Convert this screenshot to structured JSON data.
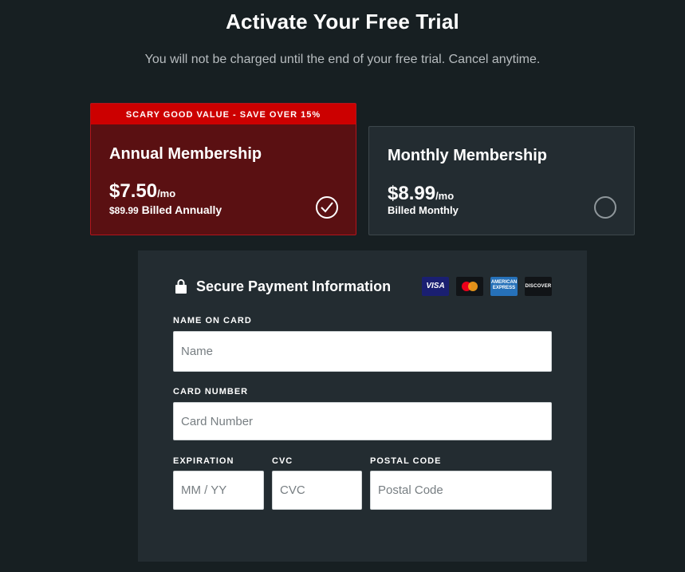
{
  "header": {
    "title": "Activate Your Free Trial",
    "subtitle": "You will not be charged until the end of your free trial. Cancel anytime."
  },
  "plans": {
    "annual": {
      "banner": "SCARY GOOD VALUE - SAVE OVER 15%",
      "name": "Annual Membership",
      "price": "$7.50",
      "price_unit": "/mo",
      "billed_amount": "$89.99",
      "billed_text": "Billed Annually",
      "selected": true
    },
    "monthly": {
      "name": "Monthly Membership",
      "price": "$8.99",
      "price_unit": "/mo",
      "billed_text": "Billed Monthly",
      "selected": false
    }
  },
  "payment": {
    "title": "Secure Payment Information",
    "cards": {
      "visa": "VISA",
      "amex_line1": "AMERICAN",
      "amex_line2": "EXPRESS",
      "discover": "DISCOVER"
    },
    "name_on_card": {
      "label": "NAME ON CARD",
      "placeholder": "Name",
      "value": ""
    },
    "card_number": {
      "label": "CARD NUMBER",
      "placeholder": "Card Number",
      "value": ""
    },
    "expiration": {
      "label": "EXPIRATION",
      "placeholder": "MM / YY",
      "value": ""
    },
    "cvc": {
      "label": "CVC",
      "placeholder": "CVC",
      "value": ""
    },
    "postal_code": {
      "label": "POSTAL CODE",
      "placeholder": "Postal Code",
      "value": ""
    }
  },
  "colors": {
    "background": "#171f22",
    "panel": "#232c31",
    "accent_red": "#cc0000",
    "annual_card": "#5a1012"
  }
}
